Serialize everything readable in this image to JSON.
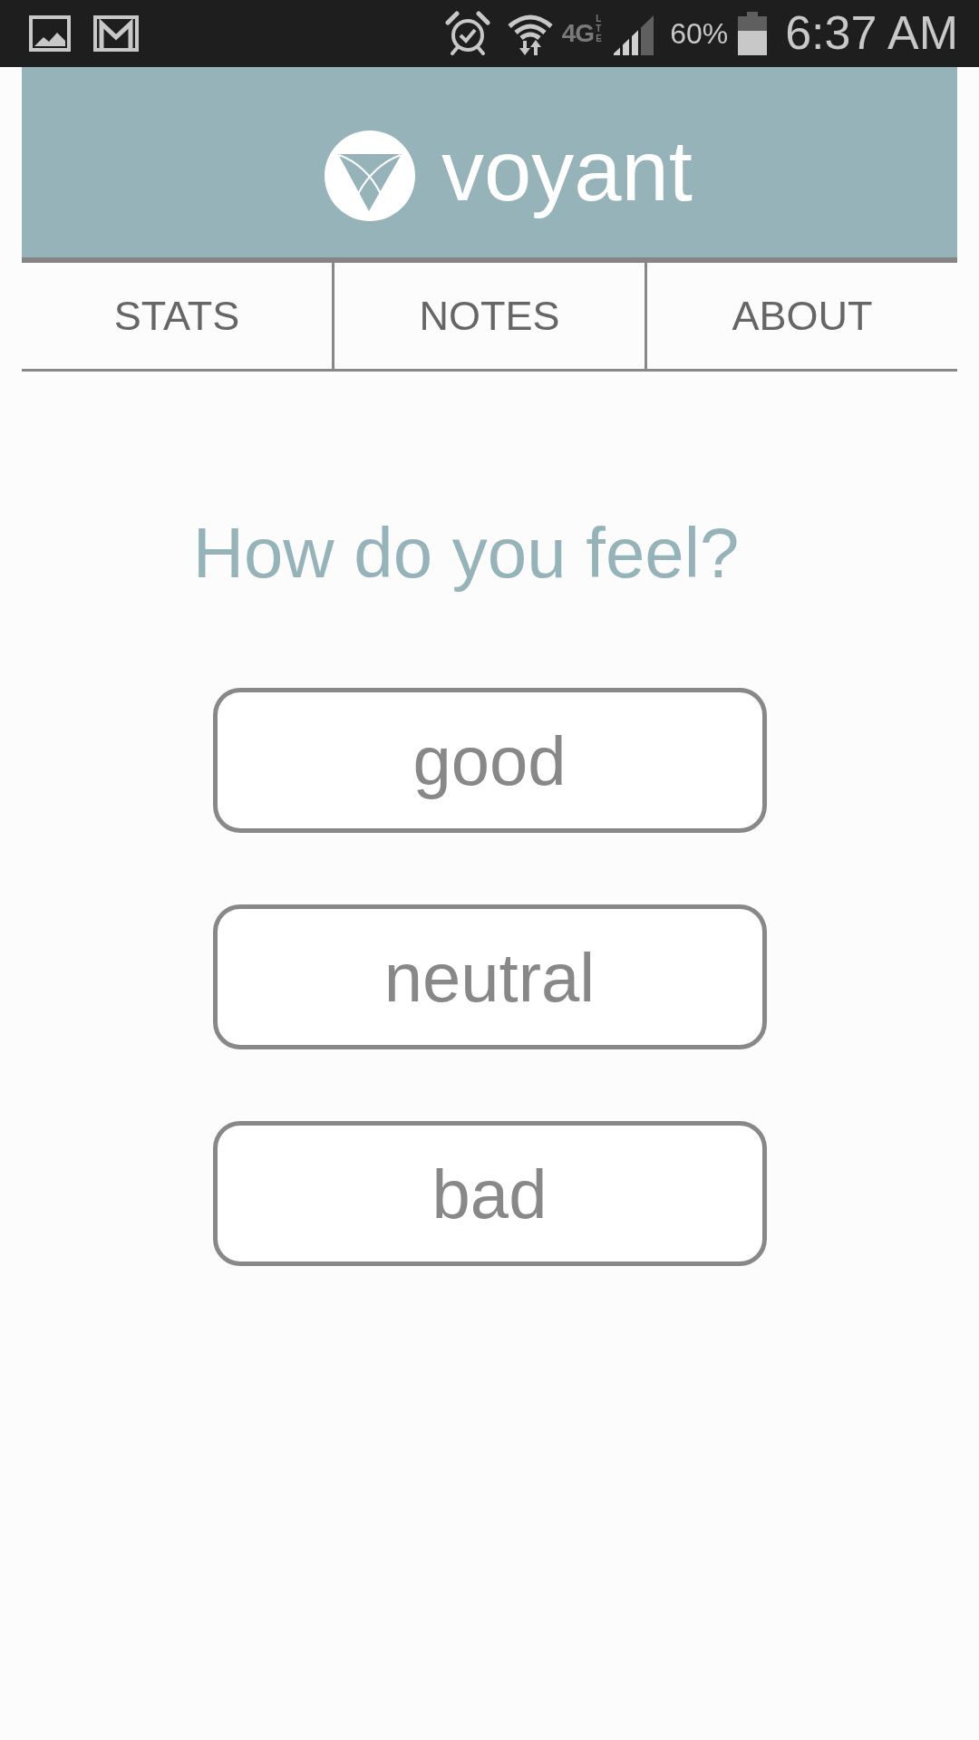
{
  "status_bar": {
    "network_type": "4G",
    "network_subtype": "LTE",
    "battery": "60%",
    "time": "6:37 AM"
  },
  "header": {
    "app_name": "voyant"
  },
  "tabs": [
    {
      "label": "STATS",
      "selected": false
    },
    {
      "label": "NOTES",
      "selected": false
    },
    {
      "label": "ABOUT",
      "selected": false
    }
  ],
  "prompt": "How do you feel?",
  "mood_buttons": [
    {
      "label": "good"
    },
    {
      "label": "neutral"
    },
    {
      "label": "bad"
    }
  ]
}
